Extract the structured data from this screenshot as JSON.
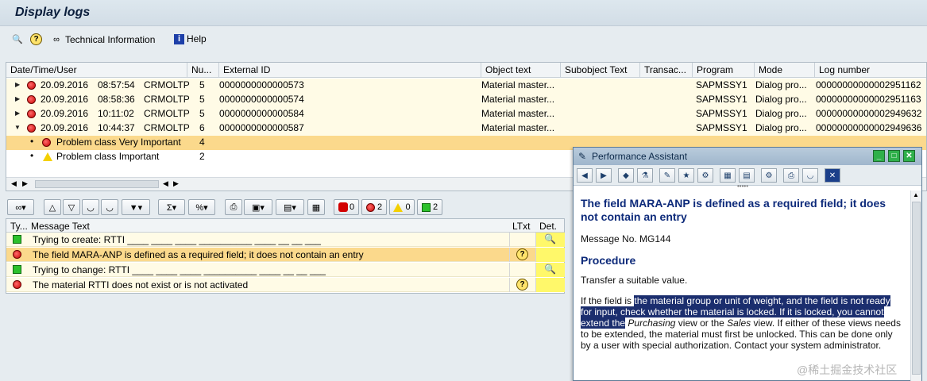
{
  "window": {
    "title": "Display logs"
  },
  "toolbar": {
    "technical_info": "Technical Information",
    "help": "Help"
  },
  "tree": {
    "columns": [
      "Date/Time/User",
      "Nu...",
      "External ID",
      "Object text",
      "Subobject Text",
      "Transac...",
      "Program",
      "Mode",
      "Log number"
    ],
    "rows": [
      {
        "date": "20.09.2016",
        "time": "08:57:54",
        "user": "CRMOLTP",
        "num": "5",
        "ext_id": "0000000000000573",
        "object": "Material master...",
        "program": "SAPMSSY1",
        "mode": "Dialog pro...",
        "log": "00000000000002951162"
      },
      {
        "date": "20.09.2016",
        "time": "08:58:36",
        "user": "CRMOLTP",
        "num": "5",
        "ext_id": "0000000000000574",
        "object": "Material master...",
        "program": "SAPMSSY1",
        "mode": "Dialog pro...",
        "log": "00000000000002951163"
      },
      {
        "date": "20.09.2016",
        "time": "10:11:02",
        "user": "CRMOLTP",
        "num": "5",
        "ext_id": "0000000000000584",
        "object": "Material master...",
        "program": "SAPMSSY1",
        "mode": "Dialog pro...",
        "log": "00000000000002949632"
      },
      {
        "date": "20.09.2016",
        "time": "10:44:37",
        "user": "CRMOLTP",
        "num": "6",
        "ext_id": "0000000000000587",
        "object": "Material master...",
        "program": "SAPMSSY1",
        "mode": "Dialog pro...",
        "log": "00000000000002949636"
      }
    ],
    "children": [
      {
        "label": "Problem class Very Important",
        "num": "4"
      },
      {
        "label": "Problem class Important",
        "num": "2"
      }
    ]
  },
  "msgbar": {
    "stop_count": "0",
    "error_count": "2",
    "warn_count": "0",
    "ok_count": "2"
  },
  "messages": {
    "headers": {
      "type": "Ty...",
      "text": "Message Text",
      "ltxt": "LTxt",
      "det": "Det."
    },
    "rows": [
      {
        "text": "Trying to create: RTTI ____ ____ ____ __________ ____ __ __ ___"
      },
      {
        "text": "The field MARA-ANP is defined as a required field; it does not contain an entry"
      },
      {
        "text": "Trying to change: RTTI ____ ____ ____ __________ ____ __ __ ___"
      },
      {
        "text": "The material RTTI does not exist or is not activated"
      }
    ]
  },
  "assistant": {
    "title": "Performance Assistant",
    "heading": "The field MARA-ANP is defined as a required field; it does not contain an entry",
    "msg_no": "Message No. MG144",
    "procedure": "Procedure",
    "transfer": "Transfer a suitable value.",
    "para_a": "If the field is ",
    "para_hl": "the material group or unit of weight, and the field is not ready for input, check whether the material is locked. If it is locked, you cannot extend the",
    "para_b": " ",
    "para_em1": "Purchasing",
    "para_c": " view or the ",
    "para_em2": "Sales",
    "para_d": " view. If either of these views needs to be extended, the material must first be unlocked. This can be done only by a user with special authorization. Contact your system administrator.",
    "watermark": "@稀土掘金技术社区"
  }
}
